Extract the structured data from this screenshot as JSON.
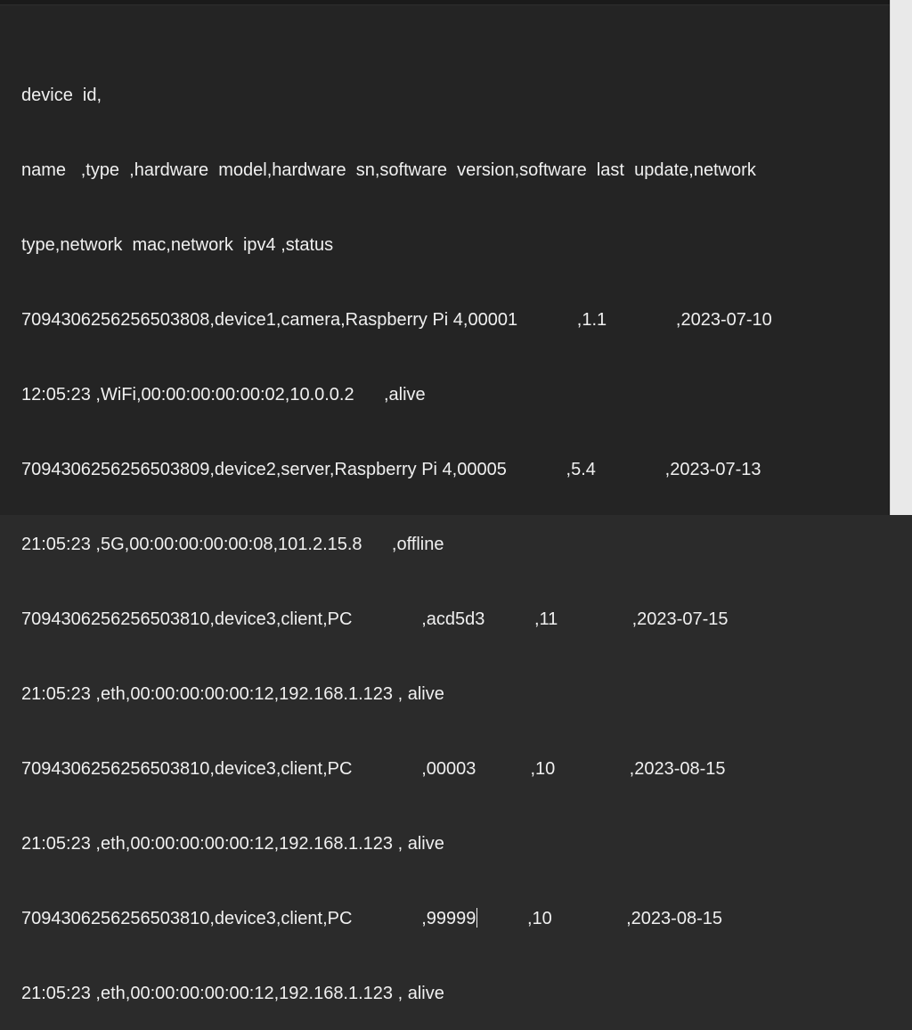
{
  "editor": {
    "lines": [
      "device  id,",
      "name   ,type  ,hardware  model,hardware  sn,software  version,software  last  update,network",
      "type,network  mac,network  ipv4 ,status",
      "7094306256256503808,device1,camera,Raspberry Pi 4,00001            ,1.1              ,2023-07-10",
      "12:05:23 ,WiFi,00:00:00:00:00:02,10.0.0.2      ,alive",
      "7094306256256503809,device2,server,Raspberry Pi 4,00005            ,5.4              ,2023-07-13",
      "21:05:23 ,5G,00:00:00:00:00:08,101.2.15.8      ,offline",
      "7094306256256503810,device3,client,PC              ,acd5d3          ,11               ,2023-07-15",
      "21:05:23 ,eth,00:00:00:00:00:12,192.168.1.123 , alive",
      "7094306256256503810,device3,client,PC              ,00003           ,10               ,2023-08-15",
      "21:05:23 ,eth,00:00:00:00:00:12,192.168.1.123 , alive",
      "7094306256256503810,device3,client,PC              ,99999",
      "          ,10               ,2023-08-15",
      "21:05:23 ,eth,00:00:00:00:00:12,192.168.1.123 , alive"
    ]
  }
}
